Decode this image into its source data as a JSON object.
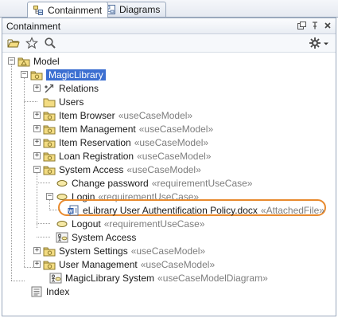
{
  "tabs": [
    {
      "label": "Containment",
      "active": true,
      "icon": "containment-icon"
    },
    {
      "label": "Diagrams",
      "active": false,
      "icon": "diagram-icon"
    }
  ],
  "panel": {
    "title": "Containment"
  },
  "toolbar": {
    "items": [
      "open-folder-icon",
      "star-icon",
      "search-icon",
      "gear-icon"
    ]
  },
  "colors": {
    "selection": "#3c6fd1",
    "highlight": "#e88a2e",
    "stereotype": "#7d7d7d"
  },
  "tree": {
    "model": {
      "label": "Model"
    },
    "magiclibrary": {
      "label": "MagicLibrary"
    },
    "relations": {
      "label": "Relations"
    },
    "users": {
      "label": "Users"
    },
    "item_browser": {
      "label": "Item Browser",
      "stereo": "«useCaseModel»"
    },
    "item_management": {
      "label": "Item Management",
      "stereo": "«useCaseModel»"
    },
    "item_reservation": {
      "label": "Item Reservation",
      "stereo": "«useCaseModel»"
    },
    "loan_registration": {
      "label": "Loan Registration",
      "stereo": "«useCaseModel»"
    },
    "system_access": {
      "label": "System Access",
      "stereo": "«useCaseModel»"
    },
    "change_password": {
      "label": "Change password",
      "stereo": "«requirementUseCase»"
    },
    "login": {
      "label": "Login",
      "stereo": "«requirementUseCase»"
    },
    "attached_file": {
      "label": "eLibrary User Authentification Policy.docx",
      "stereo": "«AttachedFile»"
    },
    "logout": {
      "label": "Logout",
      "stereo": "«requirementUseCase»"
    },
    "system_access_diagram": {
      "label": "System Access"
    },
    "system_settings": {
      "label": "System Settings",
      "stereo": "«useCaseModel»"
    },
    "user_management": {
      "label": "User Management",
      "stereo": "«useCaseModel»"
    },
    "magiclibrary_system": {
      "label": "MagicLibrary System",
      "stereo": "«useCaseModelDiagram»"
    },
    "index": {
      "label": "Index"
    }
  }
}
